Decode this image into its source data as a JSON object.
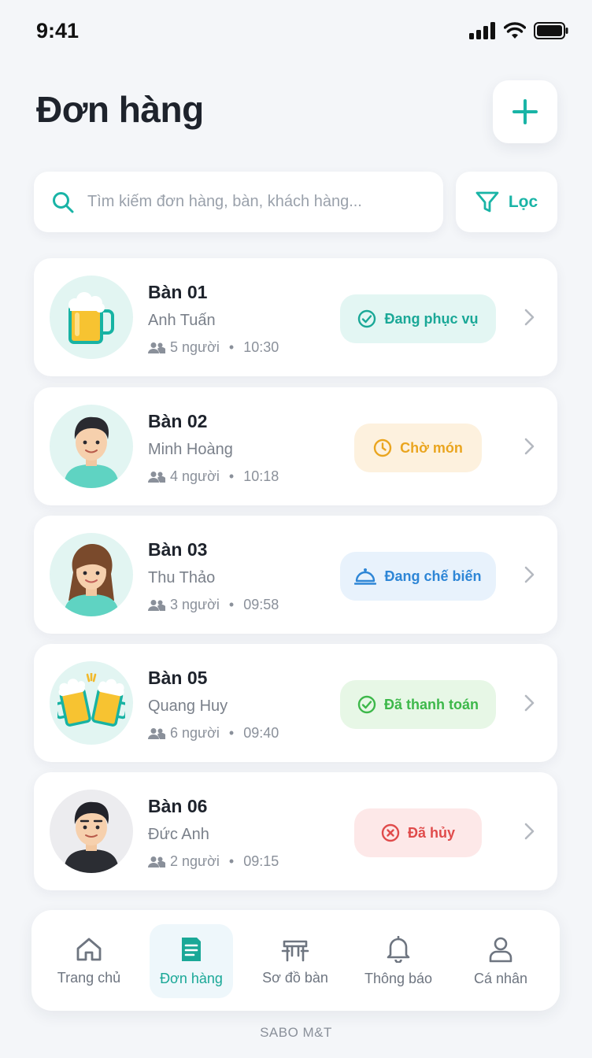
{
  "status_bar": {
    "time": "9:41"
  },
  "header": {
    "title": "Đơn hàng",
    "add_icon": "plus-icon"
  },
  "search": {
    "placeholder": "Tìm kiếm đơn hàng, bàn, khách hàng...",
    "value": ""
  },
  "filter": {
    "label": "Lọc",
    "icon": "filter-icon"
  },
  "orders": [
    {
      "table": "Bàn 01",
      "customer": "Anh Tuấn",
      "guests": "5 người",
      "time": "10:30",
      "status": "Đang phục vụ",
      "status_icon": "check-circle-icon",
      "avatar": "beer-mug"
    },
    {
      "table": "Bàn 02",
      "customer": "Minh Hoàng",
      "guests": "4 người",
      "time": "10:18",
      "status": "Chờ món",
      "status_icon": "clock-icon",
      "avatar": "man"
    },
    {
      "table": "Bàn 03",
      "customer": "Thu Thảo",
      "guests": "3 người",
      "time": "09:58",
      "status": "Đang chế biến",
      "status_icon": "cloche-icon",
      "avatar": "woman"
    },
    {
      "table": "Bàn 05",
      "customer": "Quang Huy",
      "guests": "6 người",
      "time": "09:40",
      "status": "Đã thanh toán",
      "status_icon": "check-circle-icon",
      "avatar": "beer-cheers"
    },
    {
      "table": "Bàn 06",
      "customer": "Đức Anh",
      "guests": "2 người",
      "time": "09:15",
      "status": "Đã hủy",
      "status_icon": "x-circle-icon",
      "avatar": "man-dark"
    }
  ],
  "colors": {
    "accent": "#1aa897",
    "serving": "#1aa897",
    "waiting": "#eaa51f",
    "cooking": "#2e86d6",
    "paid": "#3db84a",
    "cancelled": "#e04b4b"
  },
  "tabbar": {
    "active": "Đơn hàng",
    "items": [
      {
        "label": "Trang chủ",
        "icon": "home-icon"
      },
      {
        "label": "Đơn hàng",
        "icon": "receipt-icon"
      },
      {
        "label": "Sơ đồ bàn",
        "icon": "table-icon"
      },
      {
        "label": "Thông báo",
        "icon": "bell-icon"
      },
      {
        "label": "Cá nhân",
        "icon": "user-icon"
      }
    ]
  },
  "footer": {
    "brand": "SABO M&T"
  }
}
